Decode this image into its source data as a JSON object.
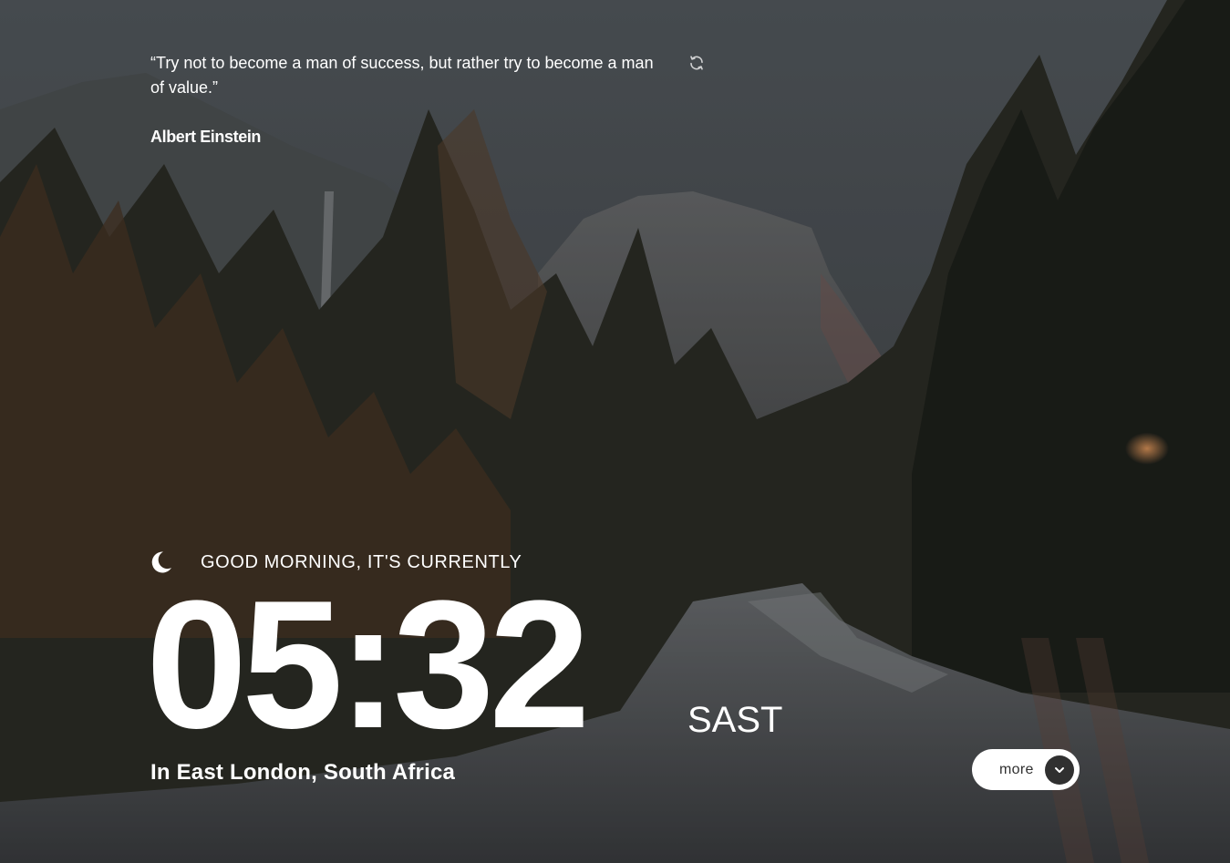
{
  "quote": {
    "text": "“Try not to become a man of success, but rather try to become a man of value.”",
    "author": "Albert Einstein",
    "refresh_icon": "refresh-icon"
  },
  "clock": {
    "greeting": "GOOD MORNING, IT'S CURRENTLY",
    "period_icon": "moon-icon",
    "time": "05:32",
    "timezone": "SAST",
    "location": "In East London, South Africa"
  },
  "more_button": {
    "label": "more",
    "icon": "chevron-down-icon"
  },
  "colors": {
    "text": "#ffffff",
    "button_bg": "#ffffff",
    "button_text": "#303030",
    "chevron_bg": "#303030"
  }
}
